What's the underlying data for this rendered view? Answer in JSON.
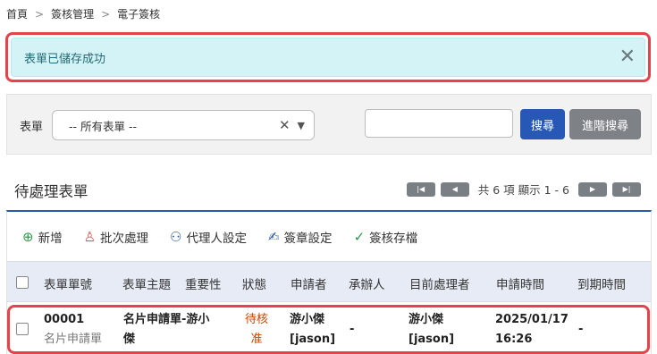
{
  "breadcrumb": [
    "首頁",
    "簽核管理",
    "電子簽核"
  ],
  "alert": {
    "message": "表單已儲存成功"
  },
  "filter": {
    "label": "表單",
    "select_value": "-- 所有表單 --",
    "search_placeholder": "",
    "search_button": "搜尋",
    "advanced_button": "進階搜尋"
  },
  "section": {
    "title": "待處理表單"
  },
  "pager": {
    "info": "共 6 項 顯示 1 - 6"
  },
  "toolbar": {
    "add": "新增",
    "batch": "批次處理",
    "agent": "代理人設定",
    "seal": "簽章設定",
    "archive": "簽核存檔"
  },
  "table": {
    "headers": [
      "表單單號",
      "表單主題",
      "重要性",
      "狀態",
      "申請者",
      "承辦人",
      "目前處理者",
      "申請時間",
      "到期時間"
    ],
    "rows": [
      {
        "form_no": "00001",
        "form_type": "名片申請單",
        "subject_line1": "名片申請單-游小",
        "subject_line2": "傑",
        "status_line1": "待核",
        "status_line2": "准",
        "applicant_line1": "游小傑",
        "applicant_line2": "[jason]",
        "handler": "-",
        "processor_line1": "游小傑",
        "processor_line2": "[jason]",
        "apply_date": "2025/01/17",
        "apply_time": "16:26",
        "due": "-"
      }
    ]
  }
}
